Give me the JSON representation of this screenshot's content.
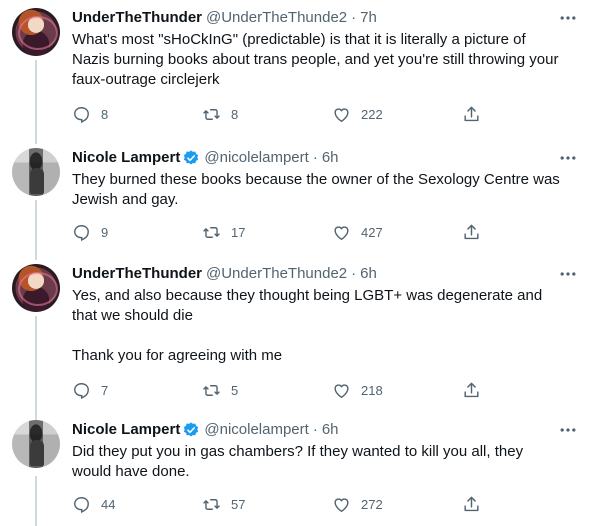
{
  "tweets": [
    {
      "author": "UnderTheThunder",
      "handle": "@UnderTheThunde2",
      "time": "7h",
      "verified": false,
      "text": "What's most \"sHoCkInG\" (predictable) is that it is literally a picture of Nazis burning books about trans people, and yet you're still throwing your faux-outrage circlejerk",
      "replies": "8",
      "retweets": "8",
      "likes": "222"
    },
    {
      "author": "Nicole Lampert",
      "handle": "@nicolelampert",
      "time": "6h",
      "verified": true,
      "text": "They burned these books because the owner of the Sexology Centre was Jewish and gay.",
      "replies": "9",
      "retweets": "17",
      "likes": "427"
    },
    {
      "author": "UnderTheThunder",
      "handle": "@UnderTheThunde2",
      "time": "6h",
      "verified": false,
      "text": "Yes, and also because they thought being LGBT+ was degenerate and that we should die\n\nThank you for agreeing with me",
      "replies": "7",
      "retweets": "5",
      "likes": "218"
    },
    {
      "author": "Nicole Lampert",
      "handle": "@nicolelampert",
      "time": "6h",
      "verified": true,
      "text": "Did they put you in gas chambers? If they wanted to kill you all, they would have done.",
      "replies": "44",
      "retweets": "57",
      "likes": "272"
    }
  ],
  "separator": "·",
  "icons": {
    "reply": "reply-icon",
    "retweet": "retweet-icon",
    "like": "heart-icon",
    "share": "share-icon",
    "more": "more-icon",
    "verified": "verified-badge-icon"
  },
  "colors": {
    "text": "#0f1419",
    "secondary": "#536471",
    "verified": "#1d9bf0",
    "thread_line": "#cfd9de"
  }
}
